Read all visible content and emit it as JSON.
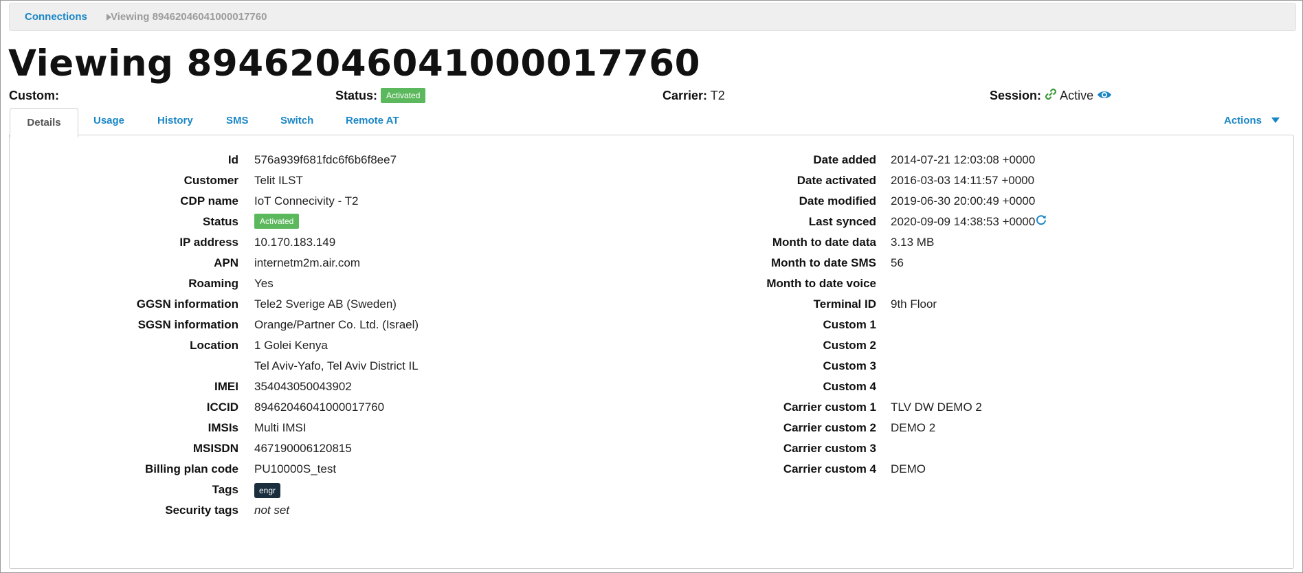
{
  "breadcrumb": {
    "root": "Connections",
    "current": "Viewing 89462046041000017760"
  },
  "title": "Viewing 89462046041000017760",
  "summary": {
    "custom_label": "Custom:",
    "status_label": "Status:",
    "status_value": "Activated",
    "carrier_label": "Carrier:",
    "carrier_value": "T2",
    "session_label": "Session:",
    "session_value": "Active"
  },
  "tabs": [
    {
      "label": "Details",
      "active": true
    },
    {
      "label": "Usage"
    },
    {
      "label": "History"
    },
    {
      "label": "SMS"
    },
    {
      "label": "Switch"
    },
    {
      "label": "Remote AT"
    }
  ],
  "actions_label": "Actions",
  "details_left": [
    {
      "label": "Id",
      "value": "576a939f681fdc6f6b6f8ee7"
    },
    {
      "label": "Customer",
      "value": "Telit ILST"
    },
    {
      "label": "CDP name",
      "value": "IoT Connecivity - T2"
    },
    {
      "label": "Status",
      "value": "Activated"
    },
    {
      "label": "IP address",
      "value": "10.170.183.149"
    },
    {
      "label": "APN",
      "value": "internetm2m.air.com"
    },
    {
      "label": "Roaming",
      "value": "Yes"
    },
    {
      "label": "GGSN information",
      "value": "Tele2 Sverige AB (Sweden)"
    },
    {
      "label": "SGSN information",
      "value": "Orange/Partner Co. Ltd. (Israel)"
    },
    {
      "label": "Location",
      "value": "1 Golei Kenya",
      "value2": "Tel Aviv-Yafo, Tel Aviv District IL"
    },
    {
      "label": "IMEI",
      "value": "354043050043902"
    },
    {
      "label": "ICCID",
      "value": "89462046041000017760"
    },
    {
      "label": "IMSIs",
      "value": "Multi IMSI"
    },
    {
      "label": "MSISDN",
      "value": "467190006120815"
    },
    {
      "label": "Billing plan code",
      "value": "PU10000S_test"
    },
    {
      "label": "Tags",
      "value": "engr"
    },
    {
      "label": "Security tags",
      "value": "not set"
    }
  ],
  "details_right": [
    {
      "label": "Date added",
      "value": "2014-07-21 12:03:08 +0000"
    },
    {
      "label": "Date activated",
      "value": "2016-03-03 14:11:57 +0000"
    },
    {
      "label": "Date modified",
      "value": "2019-06-30 20:00:49 +0000"
    },
    {
      "label": "Last synced",
      "value": "2020-09-09 14:38:53 +0000"
    },
    {
      "label": "Month to date data",
      "value": "3.13 MB"
    },
    {
      "label": "Month to date SMS",
      "value": "56"
    },
    {
      "label": "Month to date voice",
      "value": ""
    },
    {
      "label": "Terminal ID",
      "value": "9th Floor"
    },
    {
      "label": "Custom 1",
      "value": ""
    },
    {
      "label": "Custom 2",
      "value": ""
    },
    {
      "label": "Custom 3",
      "value": ""
    },
    {
      "label": "Custom 4",
      "value": ""
    },
    {
      "label": "Carrier custom 1",
      "value": "TLV DW DEMO 2"
    },
    {
      "label": "Carrier custom 2",
      "value": "DEMO 2"
    },
    {
      "label": "Carrier custom 3",
      "value": ""
    },
    {
      "label": "Carrier custom 4",
      "value": "DEMO"
    }
  ],
  "colors": {
    "link": "#1a86c6",
    "activated": "#5cb85c",
    "tag": "#1a2e3e"
  }
}
